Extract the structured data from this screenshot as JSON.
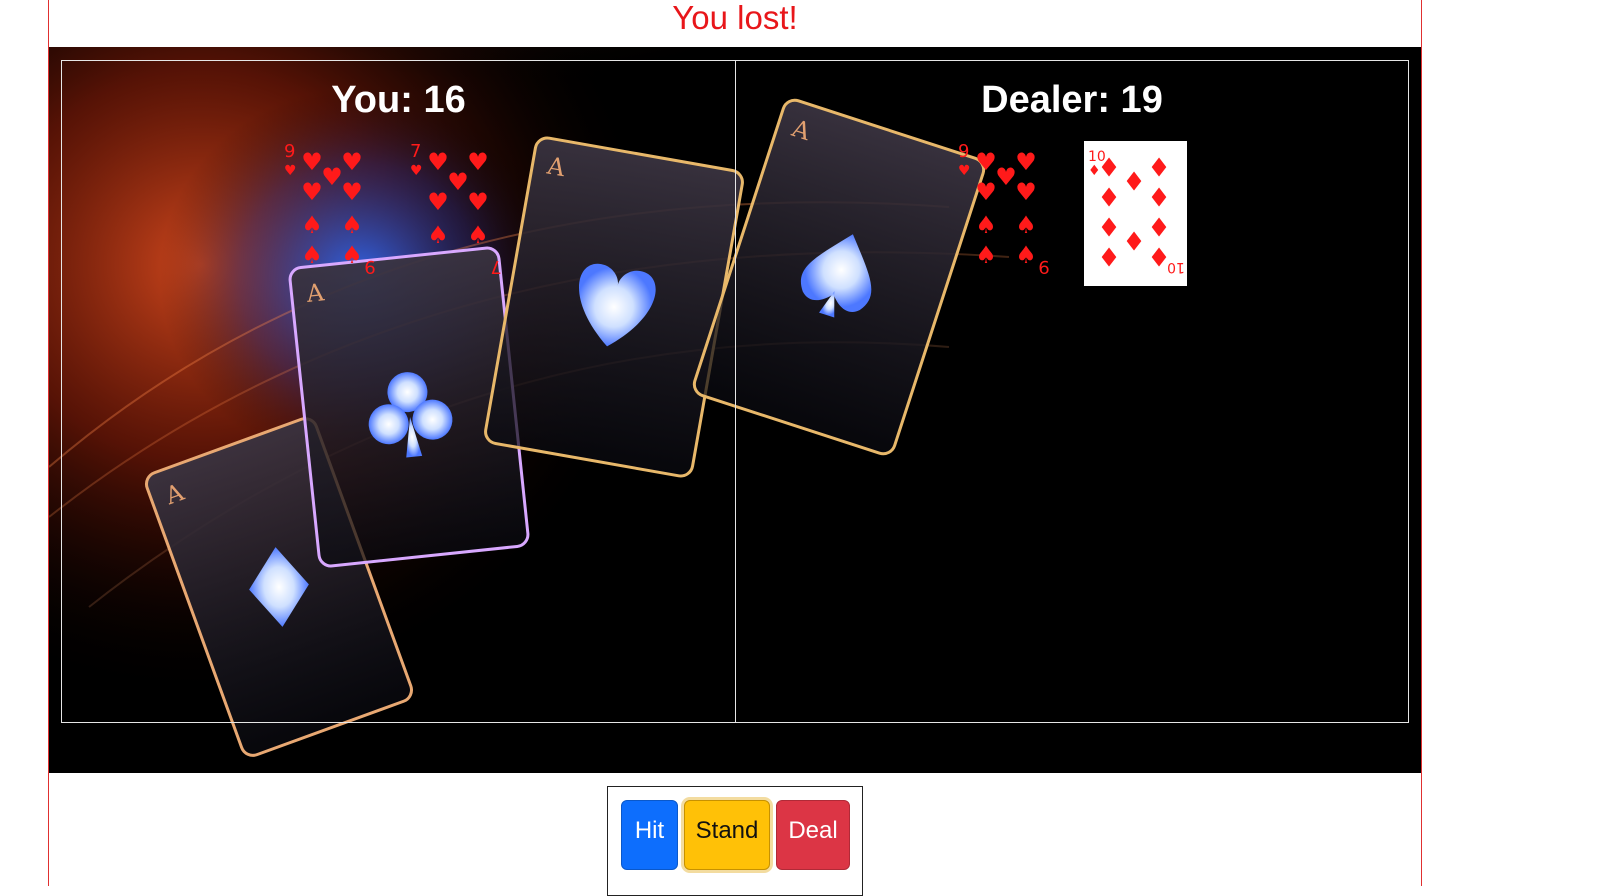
{
  "status": {
    "message": "You lost!"
  },
  "colors": {
    "status": "#e8161a",
    "table": "#000000",
    "hit": "#0d6efd",
    "stand": "#ffc107",
    "deal": "#dc3545"
  },
  "player": {
    "label": "You: 16",
    "cards": [
      {
        "rank": "9",
        "suit": "hearts",
        "face": "faded"
      },
      {
        "rank": "7",
        "suit": "hearts",
        "face": "faded"
      }
    ]
  },
  "dealer": {
    "label": "Dealer: 19",
    "cards": [
      {
        "rank": "9",
        "suit": "hearts",
        "face": "faded"
      },
      {
        "rank": "10",
        "suit": "diamonds",
        "face": "white"
      }
    ]
  },
  "controls": {
    "hit": "Hit",
    "stand": "Stand",
    "deal": "Deal"
  }
}
